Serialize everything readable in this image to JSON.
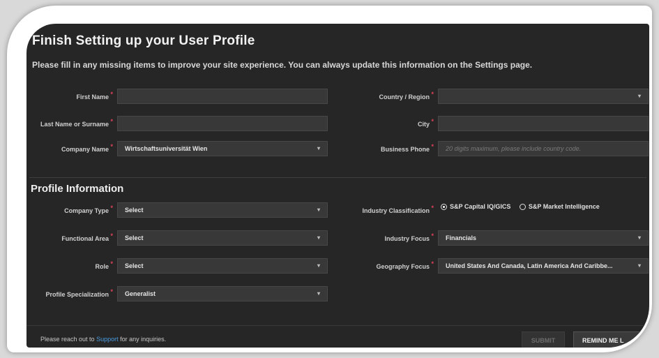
{
  "header": {
    "title": "Finish Setting up your User Profile",
    "subtitle": "Please fill in any missing items to improve your site experience. You can always update this information on the Settings page."
  },
  "user_fields": {
    "first_name": {
      "label": "First Name",
      "value": ""
    },
    "last_name": {
      "label": "Last Name or Surname",
      "value": ""
    },
    "company_name": {
      "label": "Company Name",
      "value": "Wirtschaftsuniversität Wien"
    },
    "country": {
      "label": "Country / Region",
      "value": ""
    },
    "city": {
      "label": "City",
      "value": ""
    },
    "business_phone": {
      "label": "Business Phone",
      "value": "",
      "placeholder": "20 digits maximum, please include country code."
    }
  },
  "profile": {
    "section_title": "Profile Information",
    "company_type": {
      "label": "Company Type",
      "value": "Select"
    },
    "functional_area": {
      "label": "Functional Area",
      "value": "Select"
    },
    "role": {
      "label": "Role",
      "value": "Select"
    },
    "specialization": {
      "label": "Profile Specialization",
      "value": "Generalist"
    },
    "industry_classification": {
      "label": "Industry Classification",
      "options": [
        "S&P Capital IQ/GICS",
        "S&P Market Intelligence"
      ],
      "selected": "S&P Capital IQ/GICS"
    },
    "industry_focus": {
      "label": "Industry Focus",
      "value": "Financials"
    },
    "geography_focus": {
      "label": "Geography Focus",
      "value": "United States And Canada, Latin America And Caribbe..."
    }
  },
  "footer": {
    "text_before": "Please reach out to",
    "link": "Support",
    "text_after": "for any inquiries.",
    "submit_label": "SUBMIT",
    "remind_label": "REMIND ME L"
  },
  "required_mark": "*",
  "chevron_icon": "chevron-down-icon",
  "colors": {
    "panel": "#262626",
    "field": "#383838",
    "required": "#e0435a",
    "link": "#4a9ce0"
  }
}
